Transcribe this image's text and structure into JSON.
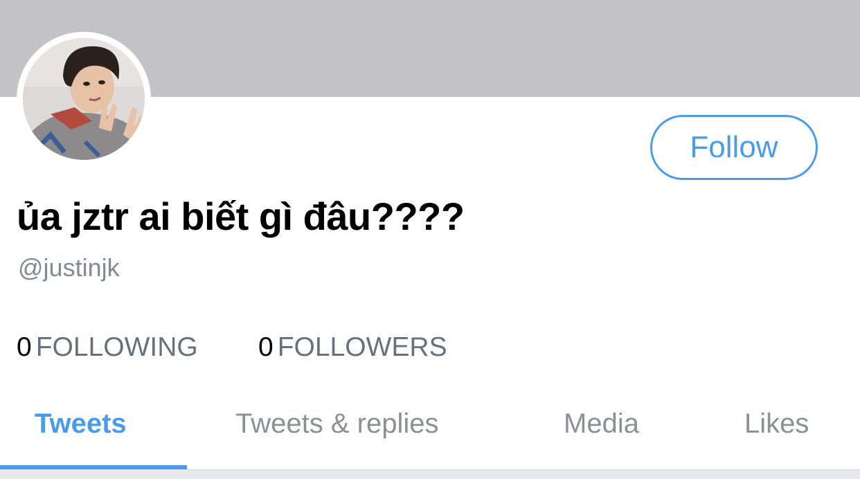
{
  "profile": {
    "display_name": "ủa jztr ai biết gì đâu????",
    "handle": "@justinjk",
    "follow_label": "Follow"
  },
  "stats": {
    "following_count": "0",
    "following_label": "FOLLOWING",
    "followers_count": "0",
    "followers_label": "FOLLOWERS"
  },
  "tabs": [
    {
      "label": "Tweets"
    },
    {
      "label": "Tweets & replies"
    },
    {
      "label": "Media"
    },
    {
      "label": "Likes"
    }
  ],
  "colors": {
    "accent": "#4a9be8",
    "banner": "#c3c3c6",
    "muted_text": "#828a92"
  }
}
